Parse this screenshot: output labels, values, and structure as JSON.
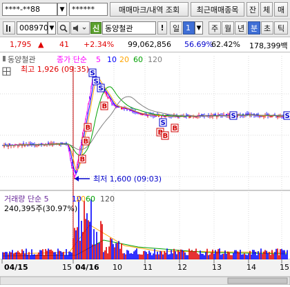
{
  "toolbar": {
    "account_value": "****-**88",
    "password_value": "******",
    "mark_button": "매매마크/내역 조회",
    "recent_button": "최근매매종목",
    "balance_button": "잔",
    "order_button": "체",
    "buy_button": "매"
  },
  "symbol_bar": {
    "code": "008970",
    "credit_badge": "신",
    "name": "동양철관",
    "bang": "!",
    "period_label": "일",
    "period_value": "1",
    "week": "주",
    "month": "월",
    "year": "년",
    "minute": "분",
    "tick": "초",
    "tab_t": "틱"
  },
  "quote": {
    "price": "1,795",
    "change_arrow": "▲",
    "change": "41",
    "change_pct": "+2.34%",
    "volume": "99,062,856",
    "ratio1": "56.69%",
    "ratio2": "62.42%",
    "value": "178,399백"
  },
  "chart": {
    "name_label": "동양철관",
    "ma_prefix": "종가 단순",
    "ma_periods": [
      "5",
      "10",
      "20",
      "60",
      "120"
    ],
    "high_label": "최고 1,926 (09:35)",
    "low_label": "최저 1,600 (09:03)",
    "volume_title": "거래량 단순 5",
    "volume_periods": [
      "10",
      "20",
      "60",
      "120"
    ],
    "volume_value": "240,395주(30.97%)",
    "x_labels": [
      "04/15",
      "15",
      "04/16",
      "10",
      "11",
      "12",
      "13",
      "14",
      "15"
    ],
    "buy_marker": "B",
    "sell_marker": "S",
    "colors": {
      "ma5": "#ff00ff",
      "ma10": "#0000ff",
      "ma20": "#ffa500",
      "ma60": "#00a000",
      "ma120": "#808080",
      "up": "#e00000",
      "down": "#0000ff",
      "cursor_line": "#c00000"
    }
  },
  "chart_data": {
    "type": "line",
    "x": [
      "04/15 09:00",
      "04/15 15:00",
      "04/16 09:03",
      "04/16 09:35",
      "04/16 10:00",
      "04/16 11:00",
      "04/16 12:00",
      "04/16 13:00",
      "04/16 14:00",
      "04/16 15:00"
    ],
    "series": [
      {
        "name": "동양철관",
        "values": [
          1705,
          1710,
          1600,
          1926,
          1830,
          1800,
          1795,
          1798,
          1800,
          1795
        ]
      }
    ],
    "high": {
      "value": 1926,
      "time": "09:35"
    },
    "low": {
      "value": 1600,
      "time": "09:03"
    },
    "volume_ratio": "30.97%"
  }
}
